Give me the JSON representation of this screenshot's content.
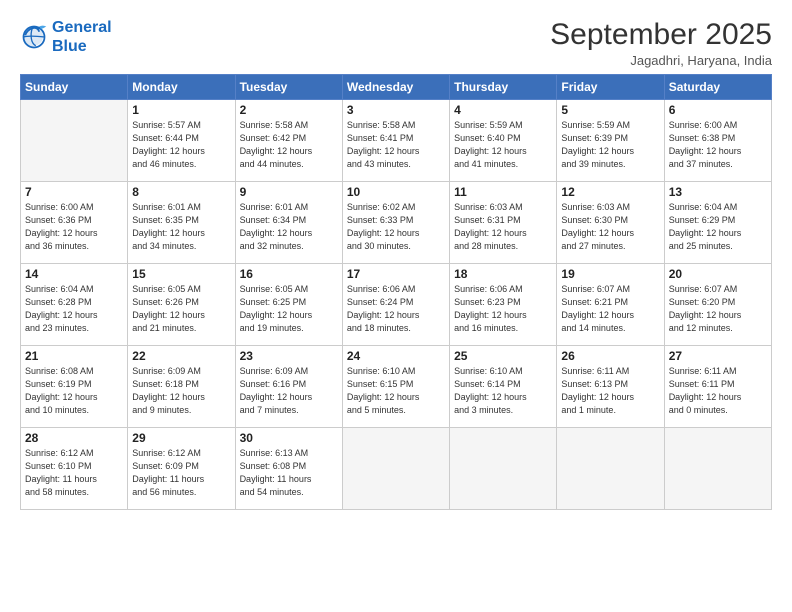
{
  "logo": {
    "line1": "General",
    "line2": "Blue"
  },
  "header": {
    "title": "September 2025",
    "subtitle": "Jagadhri, Haryana, India"
  },
  "weekdays": [
    "Sunday",
    "Monday",
    "Tuesday",
    "Wednesday",
    "Thursday",
    "Friday",
    "Saturday"
  ],
  "weeks": [
    [
      {
        "day": "",
        "info": ""
      },
      {
        "day": "1",
        "info": "Sunrise: 5:57 AM\nSunset: 6:44 PM\nDaylight: 12 hours\nand 46 minutes."
      },
      {
        "day": "2",
        "info": "Sunrise: 5:58 AM\nSunset: 6:42 PM\nDaylight: 12 hours\nand 44 minutes."
      },
      {
        "day": "3",
        "info": "Sunrise: 5:58 AM\nSunset: 6:41 PM\nDaylight: 12 hours\nand 43 minutes."
      },
      {
        "day": "4",
        "info": "Sunrise: 5:59 AM\nSunset: 6:40 PM\nDaylight: 12 hours\nand 41 minutes."
      },
      {
        "day": "5",
        "info": "Sunrise: 5:59 AM\nSunset: 6:39 PM\nDaylight: 12 hours\nand 39 minutes."
      },
      {
        "day": "6",
        "info": "Sunrise: 6:00 AM\nSunset: 6:38 PM\nDaylight: 12 hours\nand 37 minutes."
      }
    ],
    [
      {
        "day": "7",
        "info": "Sunrise: 6:00 AM\nSunset: 6:36 PM\nDaylight: 12 hours\nand 36 minutes."
      },
      {
        "day": "8",
        "info": "Sunrise: 6:01 AM\nSunset: 6:35 PM\nDaylight: 12 hours\nand 34 minutes."
      },
      {
        "day": "9",
        "info": "Sunrise: 6:01 AM\nSunset: 6:34 PM\nDaylight: 12 hours\nand 32 minutes."
      },
      {
        "day": "10",
        "info": "Sunrise: 6:02 AM\nSunset: 6:33 PM\nDaylight: 12 hours\nand 30 minutes."
      },
      {
        "day": "11",
        "info": "Sunrise: 6:03 AM\nSunset: 6:31 PM\nDaylight: 12 hours\nand 28 minutes."
      },
      {
        "day": "12",
        "info": "Sunrise: 6:03 AM\nSunset: 6:30 PM\nDaylight: 12 hours\nand 27 minutes."
      },
      {
        "day": "13",
        "info": "Sunrise: 6:04 AM\nSunset: 6:29 PM\nDaylight: 12 hours\nand 25 minutes."
      }
    ],
    [
      {
        "day": "14",
        "info": "Sunrise: 6:04 AM\nSunset: 6:28 PM\nDaylight: 12 hours\nand 23 minutes."
      },
      {
        "day": "15",
        "info": "Sunrise: 6:05 AM\nSunset: 6:26 PM\nDaylight: 12 hours\nand 21 minutes."
      },
      {
        "day": "16",
        "info": "Sunrise: 6:05 AM\nSunset: 6:25 PM\nDaylight: 12 hours\nand 19 minutes."
      },
      {
        "day": "17",
        "info": "Sunrise: 6:06 AM\nSunset: 6:24 PM\nDaylight: 12 hours\nand 18 minutes."
      },
      {
        "day": "18",
        "info": "Sunrise: 6:06 AM\nSunset: 6:23 PM\nDaylight: 12 hours\nand 16 minutes."
      },
      {
        "day": "19",
        "info": "Sunrise: 6:07 AM\nSunset: 6:21 PM\nDaylight: 12 hours\nand 14 minutes."
      },
      {
        "day": "20",
        "info": "Sunrise: 6:07 AM\nSunset: 6:20 PM\nDaylight: 12 hours\nand 12 minutes."
      }
    ],
    [
      {
        "day": "21",
        "info": "Sunrise: 6:08 AM\nSunset: 6:19 PM\nDaylight: 12 hours\nand 10 minutes."
      },
      {
        "day": "22",
        "info": "Sunrise: 6:09 AM\nSunset: 6:18 PM\nDaylight: 12 hours\nand 9 minutes."
      },
      {
        "day": "23",
        "info": "Sunrise: 6:09 AM\nSunset: 6:16 PM\nDaylight: 12 hours\nand 7 minutes."
      },
      {
        "day": "24",
        "info": "Sunrise: 6:10 AM\nSunset: 6:15 PM\nDaylight: 12 hours\nand 5 minutes."
      },
      {
        "day": "25",
        "info": "Sunrise: 6:10 AM\nSunset: 6:14 PM\nDaylight: 12 hours\nand 3 minutes."
      },
      {
        "day": "26",
        "info": "Sunrise: 6:11 AM\nSunset: 6:13 PM\nDaylight: 12 hours\nand 1 minute."
      },
      {
        "day": "27",
        "info": "Sunrise: 6:11 AM\nSunset: 6:11 PM\nDaylight: 12 hours\nand 0 minutes."
      }
    ],
    [
      {
        "day": "28",
        "info": "Sunrise: 6:12 AM\nSunset: 6:10 PM\nDaylight: 11 hours\nand 58 minutes."
      },
      {
        "day": "29",
        "info": "Sunrise: 6:12 AM\nSunset: 6:09 PM\nDaylight: 11 hours\nand 56 minutes."
      },
      {
        "day": "30",
        "info": "Sunrise: 6:13 AM\nSunset: 6:08 PM\nDaylight: 11 hours\nand 54 minutes."
      },
      {
        "day": "",
        "info": ""
      },
      {
        "day": "",
        "info": ""
      },
      {
        "day": "",
        "info": ""
      },
      {
        "day": "",
        "info": ""
      }
    ]
  ]
}
